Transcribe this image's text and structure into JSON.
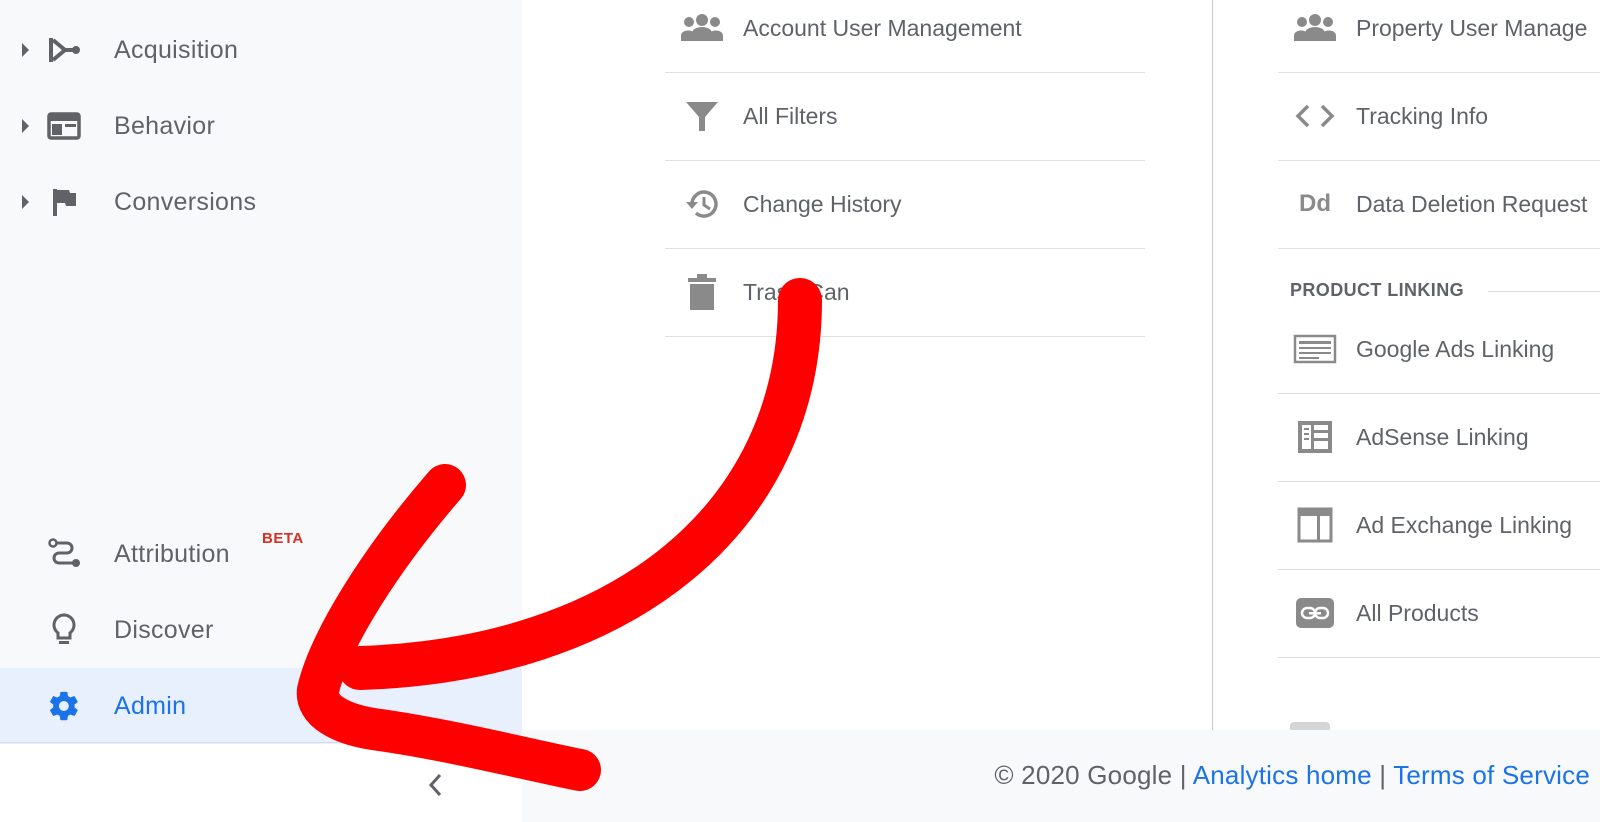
{
  "sidebar": {
    "items": [
      {
        "label": "Acquisition",
        "icon": "acquisition-icon"
      },
      {
        "label": "Behavior",
        "icon": "behavior-icon"
      },
      {
        "label": "Conversions",
        "icon": "flag-icon"
      }
    ],
    "bottom_items": [
      {
        "label": "Attribution",
        "badge": "BETA",
        "icon": "attribution-icon"
      },
      {
        "label": "Discover",
        "icon": "lightbulb-icon"
      },
      {
        "label": "Admin",
        "icon": "gear-icon",
        "active": true
      }
    ]
  },
  "account_column": {
    "items": [
      {
        "label": "Account User Management",
        "icon": "users-icon"
      },
      {
        "label": "All Filters",
        "icon": "filter-icon"
      },
      {
        "label": "Change History",
        "icon": "history-icon"
      },
      {
        "label": "Trash Can",
        "icon": "trash-icon"
      }
    ]
  },
  "property_column": {
    "items": [
      {
        "label": "Property User Manage",
        "icon": "users-icon"
      },
      {
        "label": "Tracking Info",
        "icon": "code-icon"
      },
      {
        "label": "Data Deletion Request",
        "icon": "data-deletion-icon",
        "icon_text": "Dd"
      }
    ],
    "section_header": "PRODUCT LINKING",
    "linking_items": [
      {
        "label": "Google Ads Linking",
        "icon": "google-ads-icon"
      },
      {
        "label": "AdSense Linking",
        "icon": "adsense-icon"
      },
      {
        "label": "Ad Exchange Linking",
        "icon": "ad-exchange-icon"
      },
      {
        "label": "All Products",
        "icon": "link-icon"
      }
    ]
  },
  "footer": {
    "copyright": "© 2020 Google",
    "separator": "|",
    "analytics_home": "Analytics home",
    "terms": "Terms of Service"
  },
  "colors": {
    "accent": "#1a73e8",
    "beta": "#d93025",
    "annotation_arrow": "#ff0000",
    "active_bg": "#e8f0fe"
  }
}
